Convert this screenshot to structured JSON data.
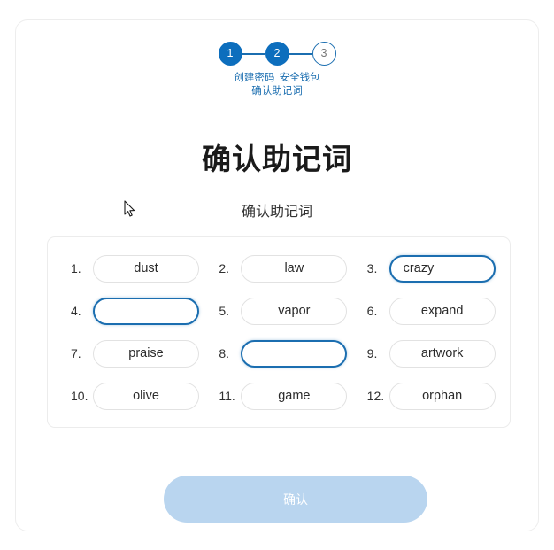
{
  "stepper": {
    "steps": [
      {
        "number": "1",
        "label": "创建密码",
        "state": "done"
      },
      {
        "number": "2",
        "label": "安全钱包",
        "state": "done"
      },
      {
        "number": "3",
        "label": "确认助记词",
        "state": "todo"
      }
    ]
  },
  "heading": {
    "title": "确认助记词",
    "subtitle": "确认助记词"
  },
  "words": {
    "items": [
      {
        "index": "1.",
        "value": "dust",
        "state": "filled",
        "caret": false
      },
      {
        "index": "2.",
        "value": "law",
        "state": "filled",
        "caret": false
      },
      {
        "index": "3.",
        "value": "crazy",
        "state": "focused",
        "caret": true
      },
      {
        "index": "4.",
        "value": "",
        "state": "focused",
        "caret": false
      },
      {
        "index": "5.",
        "value": "vapor",
        "state": "filled",
        "caret": false
      },
      {
        "index": "6.",
        "value": "expand",
        "state": "filled",
        "caret": false
      },
      {
        "index": "7.",
        "value": "praise",
        "state": "filled",
        "caret": false
      },
      {
        "index": "8.",
        "value": "",
        "state": "focused",
        "caret": false
      },
      {
        "index": "9.",
        "value": "artwork",
        "state": "filled",
        "caret": false
      },
      {
        "index": "10.",
        "value": "olive",
        "state": "filled",
        "caret": false
      },
      {
        "index": "11.",
        "value": "game",
        "state": "filled",
        "caret": false
      },
      {
        "index": "12.",
        "value": "orphan",
        "state": "filled",
        "caret": false
      }
    ]
  },
  "footer": {
    "confirm_label": "确认"
  },
  "colors": {
    "accent": "#0d6ebd",
    "accent_border": "#1b6eb0",
    "button_disabled": "#b9d5ef",
    "pill_border": "#e2e2e2",
    "card_border": "#ececec"
  }
}
